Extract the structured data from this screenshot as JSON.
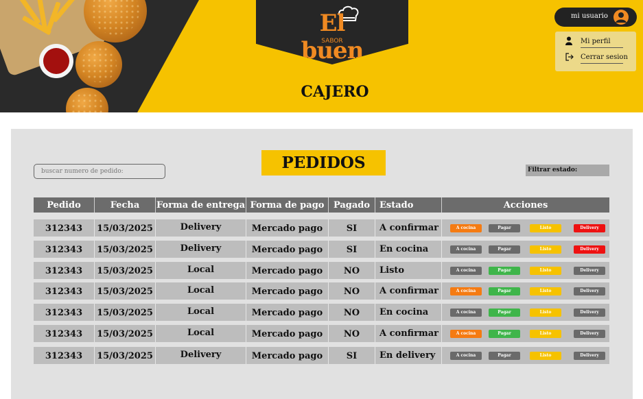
{
  "brand": {
    "name": "El buen",
    "subtitle": "SABOR"
  },
  "role_title": "CAJERO",
  "user": {
    "label": "mi usuario",
    "menu": [
      {
        "label": "Mi perfil",
        "icon": "person-icon"
      },
      {
        "label": "Cerrar sesion",
        "icon": "logout-icon"
      }
    ]
  },
  "page_title": "PEDIDOS",
  "search": {
    "placeholder": "buscar numero de pedido:"
  },
  "filter": {
    "label": "Filtrar estado:"
  },
  "table": {
    "headers": [
      "Pedido",
      "Fecha",
      "Forma de entrega",
      "Forma de pago",
      "Pagado",
      "Estado",
      "Acciones"
    ],
    "action_labels": [
      "A cocina",
      "Pagar",
      "Listo",
      "Delivery"
    ],
    "rows": [
      {
        "pedido": "312343",
        "fecha": "15/03/2025",
        "entrega": "Delivery",
        "pago": "Mercado pago",
        "pagado": "SI",
        "estado": "A confirmar",
        "actions": [
          "orange",
          "gray",
          "yellow",
          "red"
        ]
      },
      {
        "pedido": "312343",
        "fecha": "15/03/2025",
        "entrega": "Delivery",
        "pago": "Mercado pago",
        "pagado": "SI",
        "estado": "En cocina",
        "actions": [
          "gray",
          "gray",
          "yellow",
          "red"
        ]
      },
      {
        "pedido": "312343",
        "fecha": "15/03/2025",
        "entrega": "Local",
        "pago": "Mercado pago",
        "pagado": "NO",
        "estado": "Listo",
        "actions": [
          "gray",
          "green",
          "yellow",
          "gray"
        ]
      },
      {
        "pedido": "312343",
        "fecha": "15/03/2025",
        "entrega": "Local",
        "pago": "Mercado pago",
        "pagado": "NO",
        "estado": "A confirmar",
        "actions": [
          "orange",
          "green",
          "yellow",
          "gray"
        ]
      },
      {
        "pedido": "312343",
        "fecha": "15/03/2025",
        "entrega": "Local",
        "pago": "Mercado pago",
        "pagado": "NO",
        "estado": "En cocina",
        "actions": [
          "gray",
          "green",
          "yellow",
          "gray"
        ]
      },
      {
        "pedido": "312343",
        "fecha": "15/03/2025",
        "entrega": "Local",
        "pago": "Mercado pago",
        "pagado": "NO",
        "estado": "A confirmar",
        "actions": [
          "orange",
          "green",
          "yellow",
          "gray"
        ]
      },
      {
        "pedido": "312343",
        "fecha": "15/03/2025",
        "entrega": "Delivery",
        "pago": "Mercado pago",
        "pagado": "SI",
        "estado": "En delivery",
        "actions": [
          "gray",
          "gray",
          "yellow",
          "gray"
        ]
      }
    ]
  },
  "colors": {
    "brand_yellow": "#f6c200",
    "brand_orange": "#f08a22",
    "dark": "#262626",
    "btn_orange": "#f57b12",
    "btn_gray": "#6a6a6a",
    "btn_yellow": "#f6c200",
    "btn_red": "#ee1111",
    "btn_green": "#3fb54a"
  }
}
